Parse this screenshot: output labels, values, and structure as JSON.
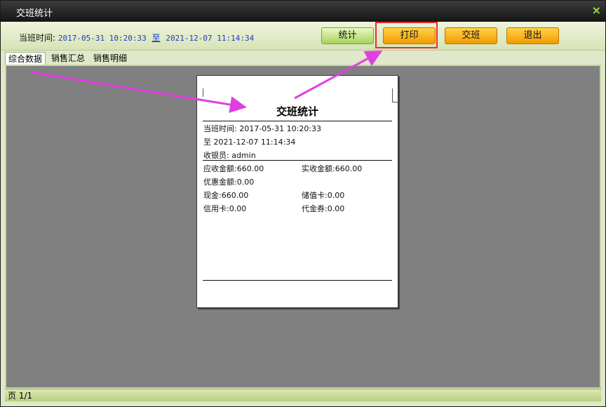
{
  "window": {
    "title": "交班统计",
    "close_label": "×"
  },
  "toolbar": {
    "duty_label": "当班时间:",
    "start_time": "2017-05-31 10:20:33",
    "to_label": "至",
    "end_time": "2021-12-07 11:14:34",
    "buttons": {
      "stat": "统计",
      "print": "打印",
      "handover": "交班",
      "exit": "退出"
    }
  },
  "tabs": [
    {
      "label": "综合数据",
      "active": true
    },
    {
      "label": "销售汇总",
      "active": false
    },
    {
      "label": "销售明细",
      "active": false
    }
  ],
  "receipt": {
    "title": "交班统计",
    "duty_line": "当班时间: 2017-05-31 10:20:33",
    "to_line": "至 2021-12-07 11:14:34",
    "cashier_line": "收银员: admin",
    "receivable": "应收金额:660.00",
    "received": "实收金额:660.00",
    "discount": "优惠金额:0.00",
    "cash": "现金:660.00",
    "stored_card": "储值卡:0.00",
    "credit_card": "信用卡:0.00",
    "voucher": "代金券:0.00"
  },
  "status": {
    "page": "页 1/1"
  },
  "colors": {
    "accent_arrow": "#e040e0",
    "highlight": "#e8312a",
    "orange_button": "#f5a400",
    "green_button": "#a7d35c"
  }
}
